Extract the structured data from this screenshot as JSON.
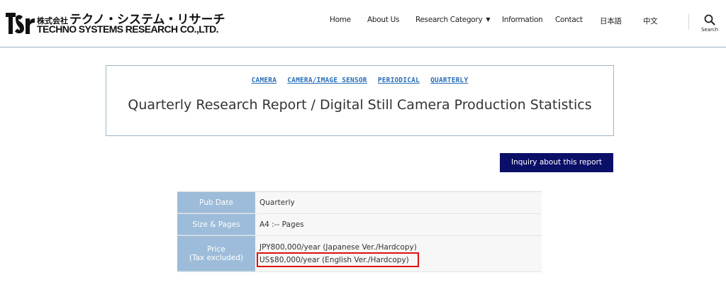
{
  "header": {
    "logo": {
      "jp_small": "株式会社",
      "jp_main": "テクノ・システム・リサーチ",
      "en": "TECHNO SYSTEMS RESEARCH CO.,LTD."
    },
    "nav": [
      {
        "label": "Home"
      },
      {
        "label": "About Us"
      },
      {
        "label": "Research Category"
      },
      {
        "label": "Information"
      },
      {
        "label": "Contact"
      },
      {
        "label": "日本語"
      },
      {
        "label": "中文"
      }
    ],
    "search_label": "Search"
  },
  "title_card": {
    "categories": [
      "CAMERA",
      "CAMERA/IMAGE SENSOR",
      "PERIODICAL",
      "QUARTERLY"
    ],
    "title": "Quarterly Research Report / Digital Still Camera Production Statistics"
  },
  "inquiry_button": "Inquiry about this report",
  "info_table": {
    "pub_date": {
      "label": "Pub Date",
      "value": "Quarterly"
    },
    "size_pages": {
      "label": "Size & Pages",
      "value": "A4 :-- Pages"
    },
    "price": {
      "label_1": "Price",
      "label_2": "(Tax excluded)",
      "jpy": "JPY800,000/year (Japanese Ver./Hardcopy)",
      "usd": "US$80,000/year (English Ver./Hardcopy)"
    }
  },
  "colors": {
    "accent_nav": "#0b0f68",
    "table_label_bg": "#9dbcd9",
    "link": "#2a6fb8",
    "highlight": "#e01010"
  }
}
